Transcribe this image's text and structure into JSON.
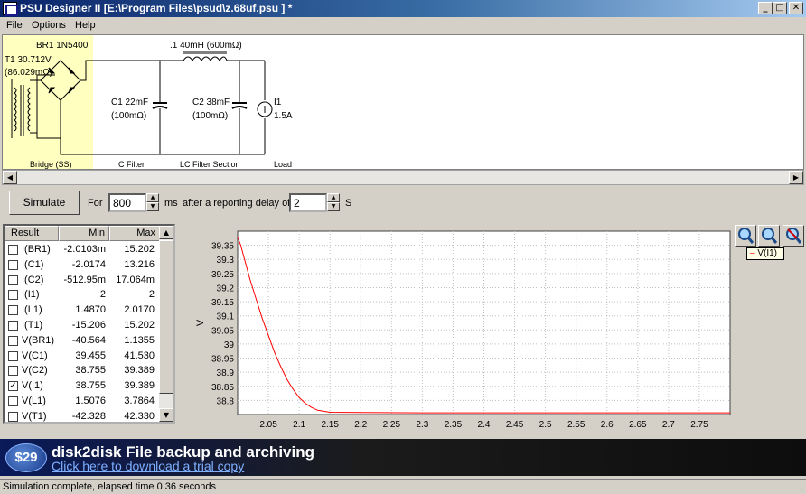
{
  "window": {
    "title": "PSU Designer II  [E:\\Program Files\\psud\\z.68uf.psu ] *",
    "buttons": [
      "_",
      "□",
      "✕"
    ]
  },
  "menu": [
    "File",
    "Options",
    "Help"
  ],
  "schematic": {
    "bridge_label": "BR1 1N5400",
    "transformer_label": "T1 30.712V",
    "transformer_res": "(86.029mΩ)",
    "inductor_label": ".1 40mH (600mΩ)",
    "c1_label": "C1 22mF",
    "c1_res": "(100mΩ)",
    "c2_label": "C2 38mF",
    "c2_res": "(100mΩ)",
    "load_label": "I1",
    "load_value": "1.5A",
    "sections": [
      "Bridge (SS)",
      "C Filter",
      "LC Filter Section",
      "Load"
    ]
  },
  "sim": {
    "button": "Simulate",
    "for_label": "For",
    "duration": "800",
    "unit_ms": "ms",
    "delay_label": "after a reporting delay of",
    "delay": "2",
    "unit_s": "S"
  },
  "results": {
    "headers": [
      "Result",
      "Min",
      "Max"
    ],
    "rows": [
      {
        "name": "I(BR1)",
        "min": "-2.0103m",
        "max": "15.202",
        "checked": false
      },
      {
        "name": "I(C1)",
        "min": "-2.0174",
        "max": "13.216",
        "checked": false
      },
      {
        "name": "I(C2)",
        "min": "-512.95m",
        "max": "17.064m",
        "checked": false
      },
      {
        "name": "I(I1)",
        "min": "2",
        "max": "2",
        "checked": false
      },
      {
        "name": "I(L1)",
        "min": "1.4870",
        "max": "2.0170",
        "checked": false
      },
      {
        "name": "I(T1)",
        "min": "-15.206",
        "max": "15.202",
        "checked": false
      },
      {
        "name": "V(BR1)",
        "min": "-40.564",
        "max": "1.1355",
        "checked": false
      },
      {
        "name": "V(C1)",
        "min": "39.455",
        "max": "41.530",
        "checked": false
      },
      {
        "name": "V(C2)",
        "min": "38.755",
        "max": "39.389",
        "checked": false
      },
      {
        "name": "V(I1)",
        "min": "38.755",
        "max": "39.389",
        "checked": true
      },
      {
        "name": "V(L1)",
        "min": "1.5076",
        "max": "3.7864",
        "checked": false
      },
      {
        "name": "V(T1)",
        "min": "-42.328",
        "max": "42.330",
        "checked": false
      }
    ]
  },
  "chart_data": {
    "type": "line",
    "ylabel": "V",
    "xlim": [
      2.0,
      2.8
    ],
    "ylim": [
      38.75,
      39.4
    ],
    "xticks": [
      "2.05",
      "2.1",
      "2.15",
      "2.2",
      "2.25",
      "2.3",
      "2.35",
      "2.4",
      "2.45",
      "2.5",
      "2.55",
      "2.6",
      "2.65",
      "2.7",
      "2.75"
    ],
    "yticks": [
      "39.35",
      "39.3",
      "39.25",
      "39.2",
      "39.15",
      "39.1",
      "39.05",
      "39",
      "38.95",
      "38.9",
      "38.85",
      "38.8"
    ],
    "grid": true,
    "series": [
      {
        "name": "V(I1)",
        "color": "#ff0000",
        "x": [
          2.0,
          2.005,
          2.01,
          2.015,
          2.02,
          2.03,
          2.04,
          2.05,
          2.06,
          2.07,
          2.08,
          2.09,
          2.1,
          2.11,
          2.12,
          2.13,
          2.15,
          2.2,
          2.3,
          2.4,
          2.5,
          2.6,
          2.7,
          2.8
        ],
        "y": [
          39.38,
          39.35,
          39.31,
          39.27,
          39.23,
          39.16,
          39.09,
          39.03,
          38.97,
          38.92,
          38.875,
          38.84,
          38.81,
          38.79,
          38.775,
          38.765,
          38.758,
          38.757,
          38.756,
          38.756,
          38.756,
          38.756,
          38.756,
          38.756
        ]
      }
    ],
    "legend": "right"
  },
  "ad": {
    "price": "$29",
    "title": "disk2disk File backup and archiving",
    "link": "Click here to download a trial copy"
  },
  "status": "Simulation complete, elapsed time 0.36 seconds"
}
